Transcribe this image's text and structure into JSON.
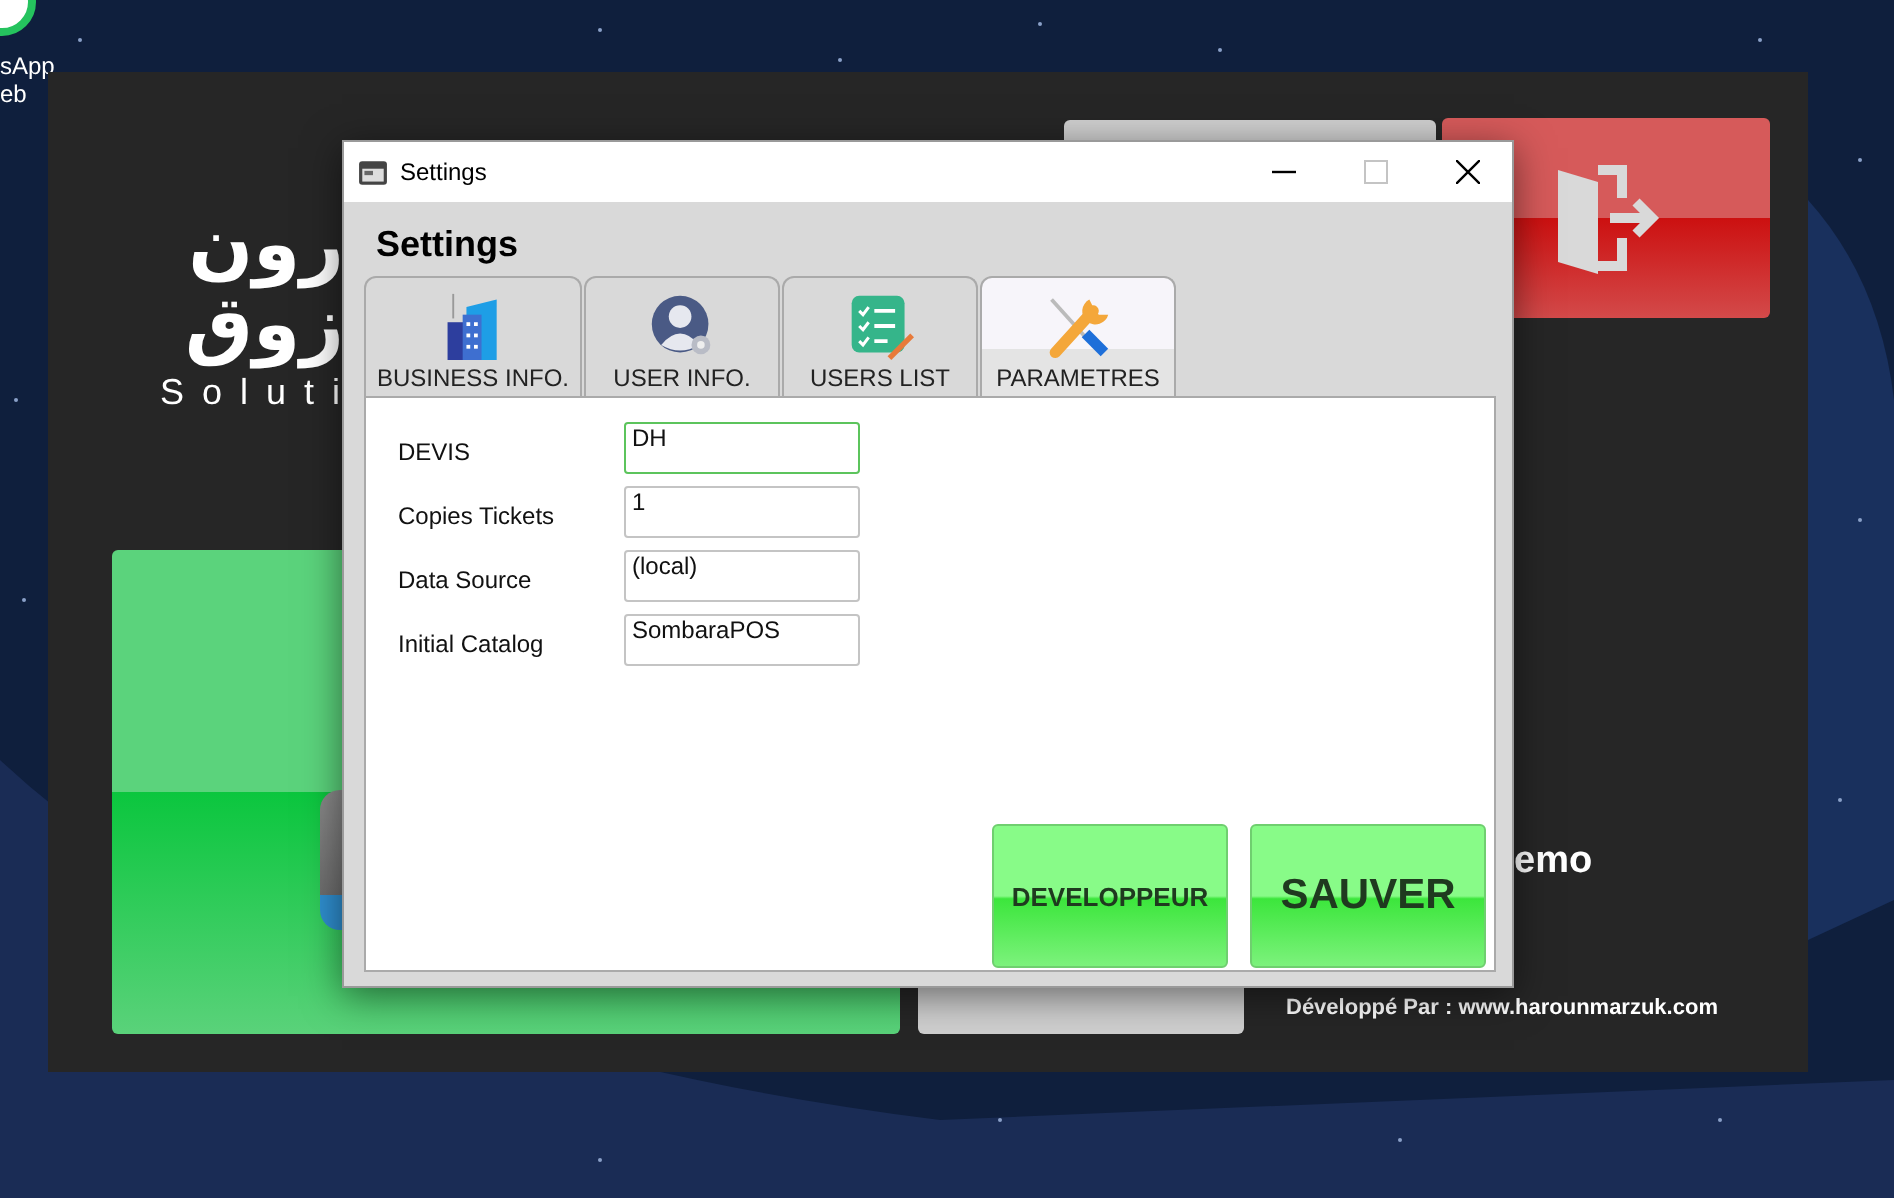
{
  "desktop": {
    "icon_label_lines": [
      "sApp",
      "eb"
    ]
  },
  "background_app": {
    "logo_lines": [
      "رون",
      "زوق"
    ],
    "logo_tagline": "Soluti",
    "demo_text": "emo",
    "credit": "Développé Par : www.harounmarzuk.com"
  },
  "dialog": {
    "title": "Settings",
    "heading": "Settings",
    "tabs": [
      {
        "label": "BUSINESS INFO.",
        "selected": false
      },
      {
        "label": "USER INFO.",
        "selected": false
      },
      {
        "label": "USERS LIST",
        "selected": false
      },
      {
        "label": "PARAMETRES",
        "selected": true
      }
    ],
    "fields": [
      {
        "label": "DEVIS",
        "value": "DH",
        "focused": true
      },
      {
        "label": "Copies Tickets",
        "value": "1",
        "focused": false
      },
      {
        "label": "Data Source",
        "value": "(local)",
        "focused": false
      },
      {
        "label": "Initial Catalog",
        "value": "SombaraPOS",
        "focused": false
      }
    ],
    "buttons": [
      {
        "label": "DEVELOPPEUR",
        "kind": "small"
      },
      {
        "label": "SAUVER",
        "kind": "large"
      }
    ]
  }
}
